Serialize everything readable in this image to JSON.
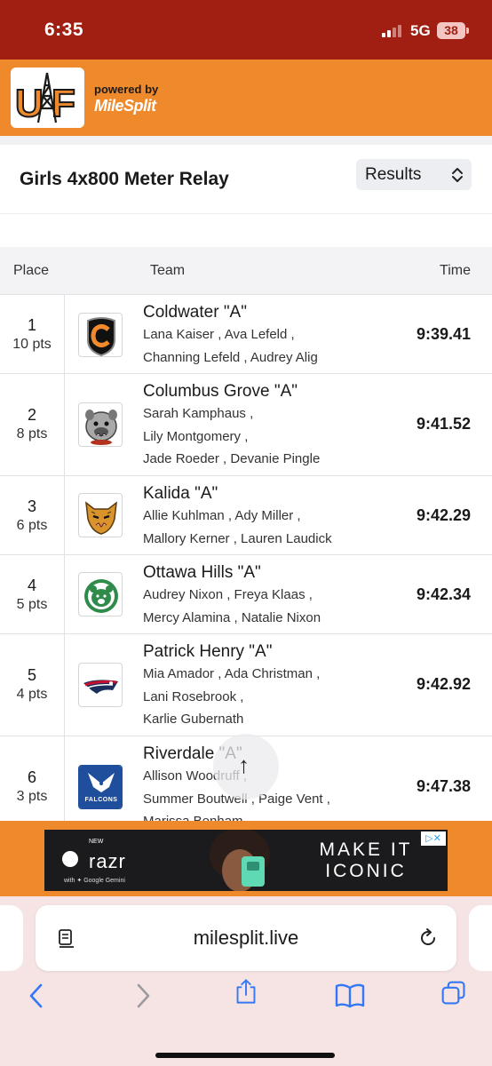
{
  "status_bar": {
    "time": "6:35",
    "network": "5G",
    "battery": "38"
  },
  "header": {
    "logo_text": "UF",
    "powered_by": "powered by",
    "brand": "MileSplit"
  },
  "event": {
    "title": "Girls 4x800 Meter Relay",
    "view_select": "Results"
  },
  "table": {
    "headers": {
      "place": "Place",
      "team": "Team",
      "time": "Time"
    },
    "rows": [
      {
        "place": "1",
        "points": "10 pts",
        "team": "Coldwater \"A\"",
        "runners": [
          "Lana Kaiser ,  Ava Lefeld ,",
          "Channing Lefeld ,  Audrey Alig"
        ],
        "time": "9:39.41",
        "logo": "coldwater-c-shield-icon"
      },
      {
        "place": "2",
        "points": "8 pts",
        "team": "Columbus Grove \"A\"",
        "runners": [
          "Sarah Kamphaus ,",
          "Lily Montgomery ,",
          "Jade Roeder ,  Devanie Pingle"
        ],
        "time": "9:41.52",
        "logo": "bulldog-icon"
      },
      {
        "place": "3",
        "points": "6 pts",
        "team": "Kalida \"A\"",
        "runners": [
          "Allie Kuhlman ,  Ady Miller ,",
          "Mallory Kerner ,  Lauren Laudick"
        ],
        "time": "9:42.29",
        "logo": "wildcat-icon"
      },
      {
        "place": "4",
        "points": "5 pts",
        "team": "Ottawa Hills \"A\"",
        "runners": [
          "Audrey Nixon ,  Freya Klaas ,",
          "Mercy Alamina ,  Natalie Nixon"
        ],
        "time": "9:42.34",
        "logo": "green-bear-icon"
      },
      {
        "place": "5",
        "points": "4 pts",
        "team": "Patrick Henry \"A\"",
        "runners": [
          "Mia Amador ,  Ada Christman ,",
          "Lani Rosebrook ,",
          "Karlie Gubernath"
        ],
        "time": "9:42.92",
        "logo": "patriot-icon"
      },
      {
        "place": "6",
        "points": "3 pts",
        "team": "Riverdale \"A\"",
        "runners": [
          "Allison Woodruff ,",
          "Summer Boutwell ,  Paige Vent ,",
          "Marissa Benham"
        ],
        "time": "9:47.38",
        "logo": "riverdale-falcons-icon",
        "logo_text": "FALCONS"
      }
    ]
  },
  "ad": {
    "new_label": "NEW",
    "product": "razr",
    "sub": "with ✦ Google Gemini",
    "headline": "MAKE IT ICONIC"
  },
  "browser": {
    "url": "milesplit.live"
  },
  "colors": {
    "status_bar": "#a11e12",
    "header": "#ef8a2c",
    "browser": "#f6e3e3",
    "link_blue": "#3478f6"
  }
}
